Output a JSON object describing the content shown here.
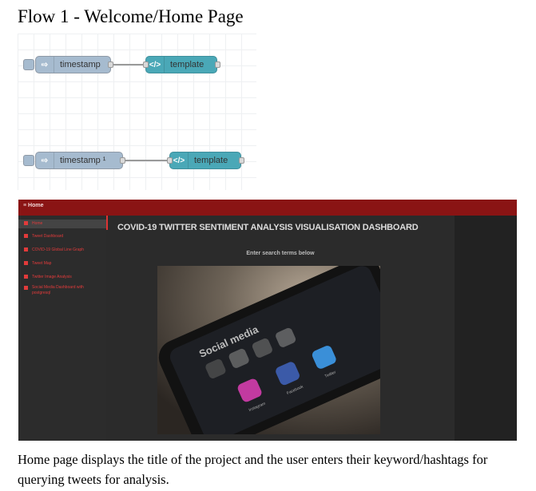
{
  "heading": "Flow 1 - Welcome/Home Page",
  "flow": {
    "row1": {
      "inject_label": "timestamp",
      "template_label": "template"
    },
    "row2": {
      "inject_label": "timestamp ¹",
      "template_label": "template"
    }
  },
  "dashboard": {
    "toolbar_title": "≡ Home",
    "nav": [
      {
        "label": "Home"
      },
      {
        "label": "Tweet Dashboard"
      },
      {
        "label": "COVID-19 Global Line Graph"
      },
      {
        "label": "Tweet Map"
      },
      {
        "label": "Twitter Image Analysis"
      },
      {
        "label": "Social Media Dashboard with postgresql"
      }
    ],
    "title": "COVID-19 TWITTER SENTIMENT ANALYSIS VISUALISATION DASHBOARD",
    "subtitle": "Enter search terms below",
    "photo_text": {
      "social": "Social media",
      "instagram": "Instagram",
      "facebook": "Facebook",
      "twitter": "Twitter"
    }
  },
  "caption": "Home page displays the title of the project and the user enters their keyword/hashtags for querying tweets for analysis.",
  "colors": {
    "toolbar": "#8a1414",
    "nav_text": "#e23b3b",
    "inject_node": "#a6bbcf",
    "template_node": "#4aa8b7"
  }
}
